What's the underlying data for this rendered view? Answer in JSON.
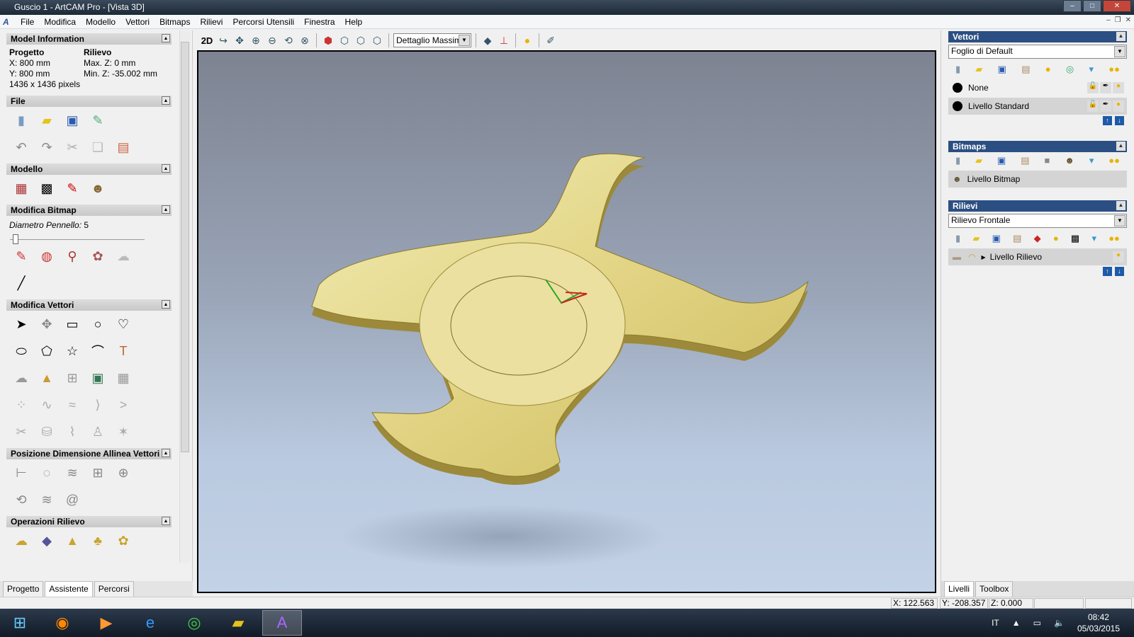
{
  "window": {
    "title": "Guscio 1 - ArtCAM Pro - [Vista 3D]"
  },
  "menu": [
    "File",
    "Modifica",
    "Modello",
    "Vettori",
    "Bitmaps",
    "Rilievi",
    "Percorsi Utensili",
    "Finestra",
    "Help"
  ],
  "left": {
    "model_info": {
      "title": "Model Information",
      "progetto": "Progetto",
      "rilievo": "Rilievo",
      "x": "X: 800 mm",
      "maxz": "Max. Z: 0 mm",
      "y": "Y: 800 mm",
      "minz": "Min. Z: -35.002 mm",
      "pixels": "1436 x 1436 pixels"
    },
    "sections": {
      "file": "File",
      "modello": "Modello",
      "modifica_bitmap": "Modifica Bitmap",
      "modifica_vettori": "Modifica Vettori",
      "posizione": "Posizione Dimensione Allinea Vettori",
      "operazioni": "Operazioni Rilievo"
    },
    "brush_label": "Diametro Pennello:",
    "brush_value": "5",
    "tabs": [
      "Progetto",
      "Assistente",
      "Percorsi"
    ]
  },
  "toolbar": {
    "mode": "2D",
    "detail": "Dettaglio Massimo"
  },
  "right": {
    "vettori": {
      "title": "Vettori",
      "sheet": "Foglio di Default",
      "layers": [
        "None",
        "Livello Standard"
      ]
    },
    "bitmaps": {
      "title": "Bitmaps",
      "layers": [
        "Livello Bitmap"
      ]
    },
    "rilievi": {
      "title": "Rilievi",
      "select": "Rilievo Frontale",
      "layers": [
        "Livello Rilievo"
      ]
    },
    "tabs": [
      "Livelli",
      "Toolbox"
    ]
  },
  "status": {
    "x": "X: 122.563",
    "y": "Y: -208.357",
    "z": "Z: 0.000"
  },
  "taskbar": {
    "lang": "IT",
    "time": "08:42",
    "date": "05/03/2015"
  }
}
